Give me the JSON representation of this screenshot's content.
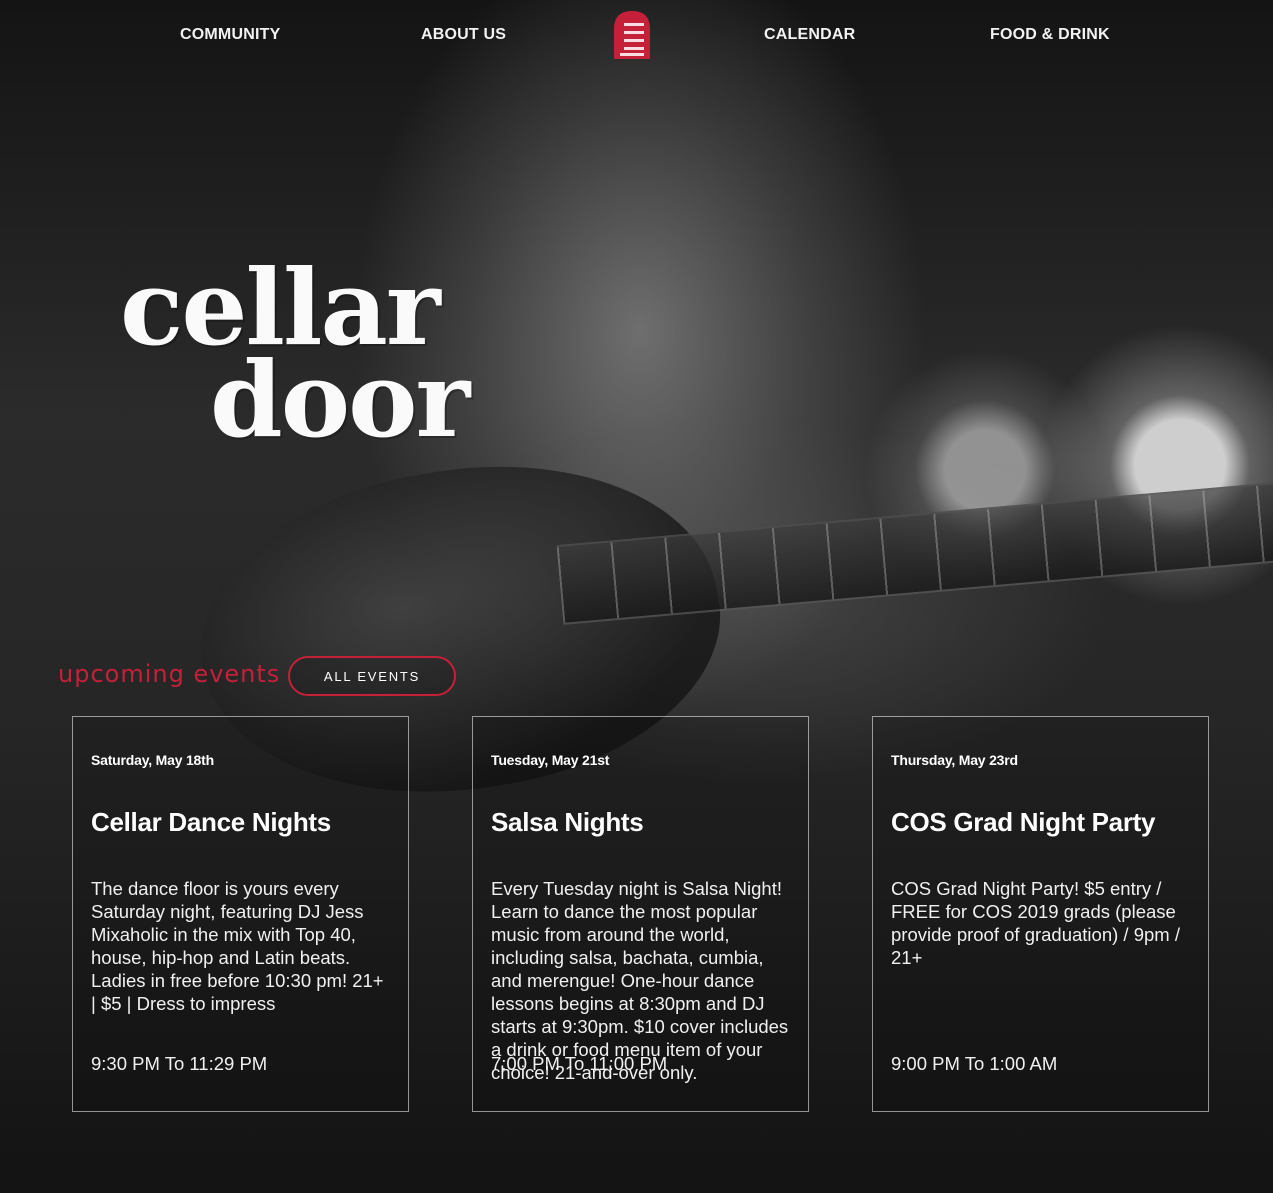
{
  "nav": {
    "items": [
      "COMMUNITY",
      "ABOUT US",
      "CALENDAR",
      "FOOD & DRINK"
    ],
    "logo_icon": "cellar-door-logo-icon"
  },
  "hero": {
    "line1": "cellar",
    "line2": "door"
  },
  "events_section": {
    "heading": "upcoming events",
    "all_events_label": "ALL EVENTS",
    "accent_color": "#c5203a"
  },
  "events": [
    {
      "date": "Saturday, May 18th",
      "title": "Cellar Dance Nights",
      "description": "The dance floor is yours every Saturday night, featuring DJ Jess Mixaholic in the mix with Top 40, house, hip-hop and Latin beats. Ladies in free before 10:30 pm! 21+ | $5 | Dress to impress",
      "time": "9:30 PM To 11:29 PM"
    },
    {
      "date": "Tuesday, May 21st",
      "title": "Salsa Nights",
      "description": "Every Tuesday night is Salsa Night! Learn to dance the most popular music from around the world, including salsa, bachata, cumbia, and merengue! One-hour dance lessons begins at 8:30pm and DJ starts at 9:30pm. $10 cover includes a drink or food menu item of your choice! 21-and-over only.",
      "time": "7:00 PM To 11:00 PM"
    },
    {
      "date": "Thursday, May 23rd",
      "title": "COS Grad Night Party",
      "description": "COS Grad Night Party! $5 entry / FREE for COS 2019 grads (please provide proof of graduation) / 9pm / 21+",
      "time": "9:00 PM To 1:00 AM"
    }
  ]
}
